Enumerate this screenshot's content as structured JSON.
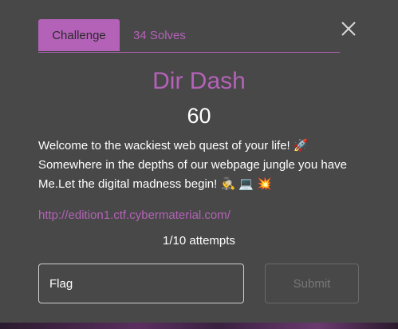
{
  "tabs": [
    {
      "label": "Challenge",
      "active": true
    },
    {
      "label": "34 Solves",
      "active": false
    }
  ],
  "challenge": {
    "name": "Dir Dash",
    "points": "60",
    "description_line1": "Welcome to the wackiest web quest of your life! 🚀",
    "description_line2": "Somewhere in the depths of our webpage jungle you have",
    "description_line3": "Me.Let the digital madness begin! 🕵️ 💻 💥",
    "link": "http://edition1.ctf.cybermaterial.com/",
    "attempts": "1/10 attempts"
  },
  "form": {
    "flag_placeholder": "Flag",
    "submit_label": "Submit"
  },
  "colors": {
    "accent": "#b462b8",
    "background": "#484848"
  },
  "icons": {
    "close": "close-icon"
  }
}
